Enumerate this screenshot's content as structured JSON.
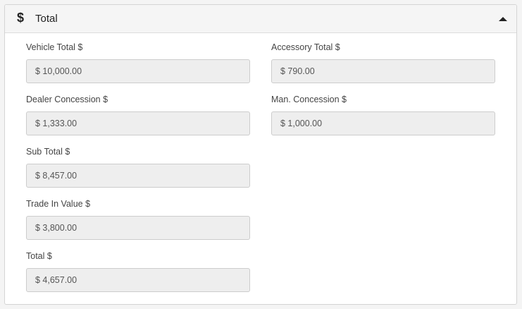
{
  "panel": {
    "icon": "dollar-icon",
    "icon_glyph": "$",
    "title": "Total",
    "toggle_icon": "caret-up-icon"
  },
  "fields": {
    "vehicle_total": {
      "label": "Vehicle Total $",
      "value": "$ 10,000.00"
    },
    "accessory_total": {
      "label": "Accessory Total $",
      "value": "$ 790.00"
    },
    "dealer_concession": {
      "label": "Dealer Concession $",
      "value": "$ 1,333.00"
    },
    "man_concession": {
      "label": "Man. Concession $",
      "value": "$ 1,000.00"
    },
    "sub_total": {
      "label": "Sub Total $",
      "value": "$ 8,457.00"
    },
    "trade_in_value": {
      "label": "Trade In Value $",
      "value": "$ 3,800.00"
    },
    "total": {
      "label": "Total $",
      "value": "$ 4,657.00"
    }
  }
}
